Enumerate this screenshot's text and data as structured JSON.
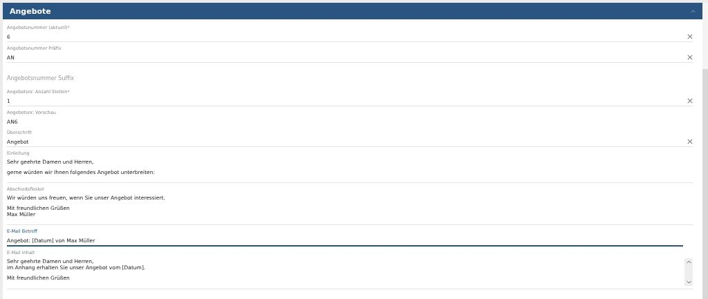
{
  "panel": {
    "title": "Angebote",
    "expanded": true
  },
  "fields": [
    {
      "kind": "text",
      "label": "Angebotsnummer (aktuell)*",
      "value": "6"
    },
    {
      "kind": "text",
      "label": "Angebotsnummer Präfix",
      "value": "AN"
    },
    {
      "kind": "empty",
      "label": "Angebotsnummer Suffix"
    },
    {
      "kind": "text",
      "label": "Angebotsnr. Anzahl Stellen*",
      "value": "1"
    },
    {
      "kind": "readonly",
      "label": "Angebotsnr. Vorschau",
      "value": "AN6"
    },
    {
      "kind": "text",
      "label": "Überschrift",
      "value": "Angebot"
    },
    {
      "kind": "textarea",
      "label": "Einleitung",
      "paragraphs": [
        [
          "Sehr geehrte Damen und Herren,"
        ],
        [
          "gerne würden wir Ihnen folgendes Angebot unterbreiten:"
        ]
      ]
    },
    {
      "kind": "textarea",
      "label": "Abschiedsfloskel",
      "paragraphs": [
        [
          "Wir würden uns freuen, wenn Sie unser Angebot interessiert."
        ],
        [
          "Mit freundlichen Grüßen",
          "Max Müller"
        ]
      ]
    },
    {
      "kind": "focused",
      "label": "E-Mail Betreff",
      "value": "Angebot: [Datum] von Max Müller"
    },
    {
      "kind": "scrollarea",
      "label": "E-Mail Inhalt",
      "paragraphs": [
        [
          "Sehr geehrte Damen und Herren,",
          "im Anhang erhalten Sie unser Angebot vom [Datum]."
        ],
        [
          "Mit freundlichen Grüßen"
        ]
      ]
    }
  ]
}
